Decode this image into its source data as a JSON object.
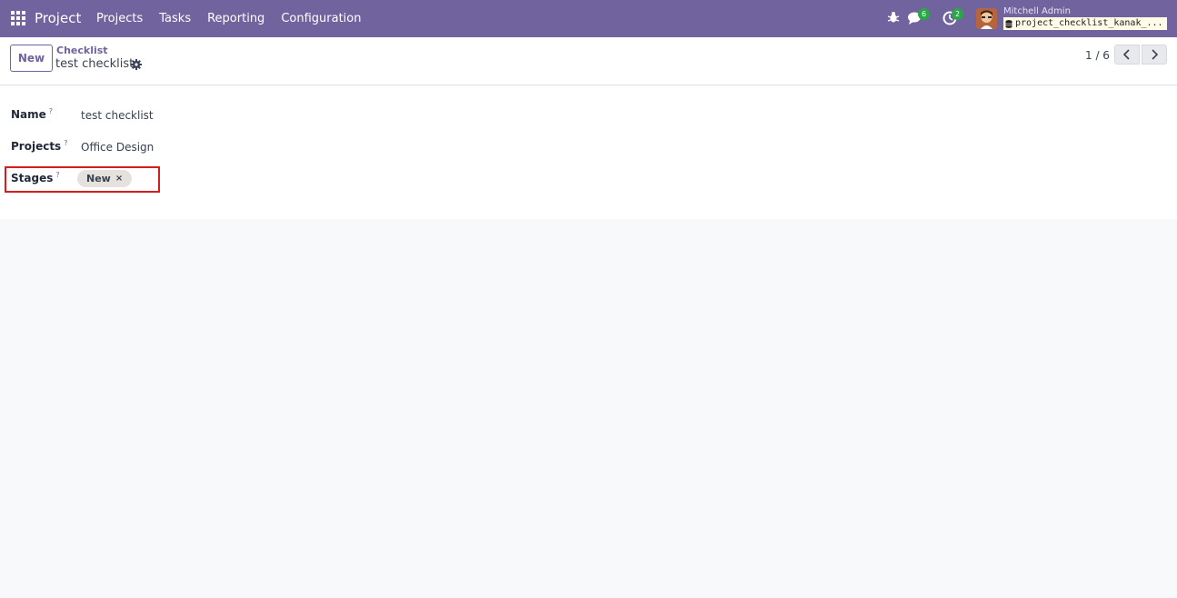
{
  "navbar": {
    "app_name": "Project",
    "menu": [
      "Projects",
      "Tasks",
      "Reporting",
      "Configuration"
    ],
    "chat_badge": "6",
    "activity_badge": "2",
    "user_name": "Mitchell Admin",
    "db_name": "project_checklist_kanak_...",
    "icons": [
      "apps-icon",
      "bug-icon",
      "chat-icon",
      "clock-icon",
      "database-icon"
    ],
    "color": "#71639e"
  },
  "control_panel": {
    "new_label": "New",
    "breadcrumb": "Checklist",
    "record_title": "test checklist",
    "pager": "1 / 6"
  },
  "form": {
    "name_label": "Name",
    "name_value": "test checklist",
    "projects_label": "Projects",
    "projects_value": "Office Design",
    "stages_label": "Stages",
    "stage_tags": [
      "New"
    ],
    "help_mark": "?",
    "remove_mark": "×"
  },
  "highlight_color": "#d61c1c"
}
